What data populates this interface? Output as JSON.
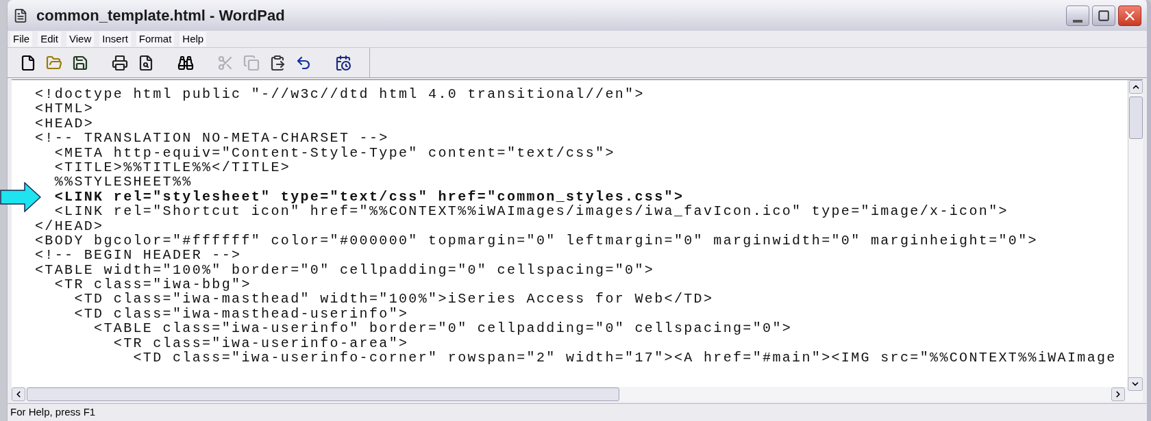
{
  "window": {
    "title": "common_template.html - WordPad"
  },
  "menu": [
    "File",
    "Edit",
    "View",
    "Insert",
    "Format",
    "Help"
  ],
  "toolbar": [
    {
      "kind": "new",
      "disabled": false
    },
    {
      "kind": "open",
      "disabled": false
    },
    {
      "kind": "save",
      "disabled": false
    },
    {
      "kind": "print",
      "disabled": false
    },
    {
      "kind": "preview",
      "disabled": false
    },
    {
      "kind": "find",
      "disabled": false
    },
    {
      "kind": "cut",
      "disabled": true
    },
    {
      "kind": "copy",
      "disabled": true
    },
    {
      "kind": "paste",
      "disabled": false
    },
    {
      "kind": "undo",
      "disabled": false
    },
    {
      "kind": "datetime",
      "disabled": false
    }
  ],
  "document": {
    "lines": [
      {
        "text": "<!doctype html public \"-//w3c//dtd html 4.0 transitional//en\">",
        "emphasized": false
      },
      {
        "text": "<HTML>",
        "emphasized": false
      },
      {
        "text": "<HEAD>",
        "emphasized": false
      },
      {
        "text": "<!-- TRANSLATION NO-META-CHARSET -->",
        "emphasized": false
      },
      {
        "text": "  <META http-equiv=\"Content-Style-Type\" content=\"text/css\">",
        "emphasized": false
      },
      {
        "text": "  <TITLE>%%TITLE%%</TITLE>",
        "emphasized": false
      },
      {
        "text": "  %%STYLESHEET%%",
        "emphasized": false
      },
      {
        "text": "  <LINK rel=\"stylesheet\" type=\"text/css\" href=\"common_styles.css\">",
        "emphasized": true
      },
      {
        "text": "  <LINK rel=\"Shortcut icon\" href=\"%%CONTEXT%%iWAImages/images/iwa_favIcon.ico\" type=\"image/x-icon\">",
        "emphasized": false
      },
      {
        "text": "</HEAD>",
        "emphasized": false
      },
      {
        "text": "<BODY bgcolor=\"#ffffff\" color=\"#000000\" topmargin=\"0\" leftmargin=\"0\" marginwidth=\"0\" marginheight=\"0\">",
        "emphasized": false
      },
      {
        "text": "<!-- BEGIN HEADER -->",
        "emphasized": false
      },
      {
        "text": "<TABLE width=\"100%\" border=\"0\" cellpadding=\"0\" cellspacing=\"0\">",
        "emphasized": false
      },
      {
        "text": "  <TR class=\"iwa-bbg\">",
        "emphasized": false
      },
      {
        "text": "    <TD class=\"iwa-masthead\" width=\"100%\">iSeries Access for Web</TD>",
        "emphasized": false
      },
      {
        "text": "    <TD class=\"iwa-masthead-userinfo\">",
        "emphasized": false
      },
      {
        "text": "      <TABLE class=\"iwa-userinfo\" border=\"0\" cellpadding=\"0\" cellspacing=\"0\">",
        "emphasized": false
      },
      {
        "text": "        <TR class=\"iwa-userinfo-area\">",
        "emphasized": false
      },
      {
        "text": "          <TD class=\"iwa-userinfo-corner\" rowspan=\"2\" width=\"17\"><A href=\"#main\"><IMG src=\"%%CONTEXT%%iWAImage",
        "emphasized": false
      }
    ]
  },
  "status_bar": "For Help, press F1"
}
